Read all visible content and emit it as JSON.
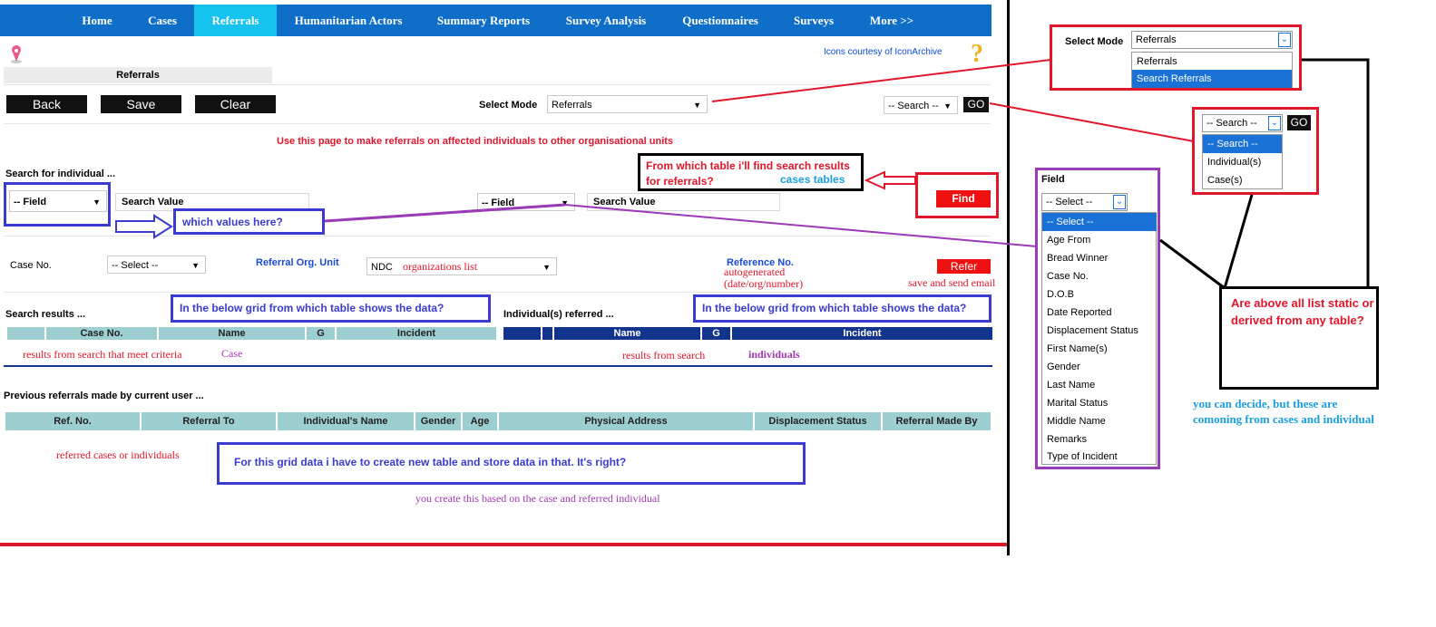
{
  "nav": {
    "items": [
      "Home",
      "Cases",
      "Referrals",
      "Humanitarian Actors",
      "Summary Reports",
      "Survey Analysis",
      "Questionnaires",
      "Surveys",
      "More >>"
    ],
    "active": "Referrals"
  },
  "header": {
    "credit": "Icons courtesy of IconArchive",
    "section_title": "Referrals"
  },
  "toolbar": {
    "back": "Back",
    "save": "Save",
    "clear": "Clear",
    "select_mode_label": "Select Mode",
    "select_mode_value": "Referrals",
    "search_value": "-- Search --",
    "go": "GO"
  },
  "instructions": "Use this page to make referrals on affected individuals to other organisational units",
  "search": {
    "title": "Search for individual ...",
    "field1": "--  Field",
    "value1_placeholder": "Search Value",
    "field2": "--  Field",
    "value2_placeholder": "Search Value",
    "find": "Find"
  },
  "referral_form": {
    "case_no_label": "Case No.",
    "case_no_value": "-- Select --",
    "org_unit_label": "Referral Org. Unit",
    "org_unit_value": "NDC",
    "reference_label": "Reference No.",
    "refer": "Refer"
  },
  "results": {
    "title": "Search results ...",
    "columns": [
      "Case No.",
      "Name",
      "G",
      "Incident"
    ]
  },
  "referred": {
    "title": "Individual(s) referred ...",
    "columns": [
      "Name",
      "G",
      "Incident"
    ]
  },
  "previous": {
    "title": "Previous referrals made by current user ...",
    "columns": [
      "Ref. No.",
      "Referral To",
      "Individual's Name",
      "Gender",
      "Age",
      "Physical Address",
      "Displacement Status",
      "Referral Made By"
    ]
  },
  "annotations": {
    "from_which_table": "From which table i'll find search results for referrals?",
    "cases_tables": "cases tables",
    "which_values": "which values here?",
    "organizations_list": "organizations list",
    "autogenerated": "autogenerated",
    "autogen_format": "(date/org/number)",
    "save_send_email": "save and send email",
    "grid_question_left": "In the below grid from which table shows the data?",
    "grid_question_right": "In the below grid from which table shows the data?",
    "results_meet_criteria": "results from search that meet criteria",
    "case": "Case",
    "results_from_search": "results from search",
    "individuals": "individuals",
    "referred_cases": "referred cases or individuals",
    "new_table_question": "For this grid data i have to create new table and store data in that. It's right?",
    "you_create": "you create this based on the case and referred individual",
    "static_question": "Are above all list static or derived from any table?",
    "you_can_decide": "you can decide, but these are comoning from cases and individual"
  },
  "zoom_select_mode": {
    "label": "Select Mode",
    "value": "Referrals",
    "options": [
      "Referrals",
      "Search Referrals"
    ],
    "highlighted": "Search Referrals"
  },
  "zoom_search": {
    "value": "-- Search --",
    "go": "GO",
    "options": [
      "-- Search --",
      "Individual(s)",
      "Case(s)"
    ],
    "highlighted": "-- Search --"
  },
  "zoom_field": {
    "label": "Field",
    "value": "-- Select --",
    "options": [
      "-- Select --",
      "Age From",
      "Bread Winner",
      "Case No.",
      "D.O.B",
      "Date Reported",
      "Displacement Status",
      "First Name(s)",
      "Gender",
      "Last Name",
      "Marital Status",
      "Middle Name",
      "Remarks",
      "Type of Incident"
    ],
    "highlighted": "-- Select --"
  },
  "colors": {
    "nav": "#0f6ec8",
    "nav_active": "#16c3ee",
    "annotation_red": "#e0162b",
    "annotation_blue": "#3b3bd0",
    "annotation_purple": "#9b3bb8",
    "grid_teal": "#9ecfd0",
    "grid_navy": "#12348c"
  }
}
